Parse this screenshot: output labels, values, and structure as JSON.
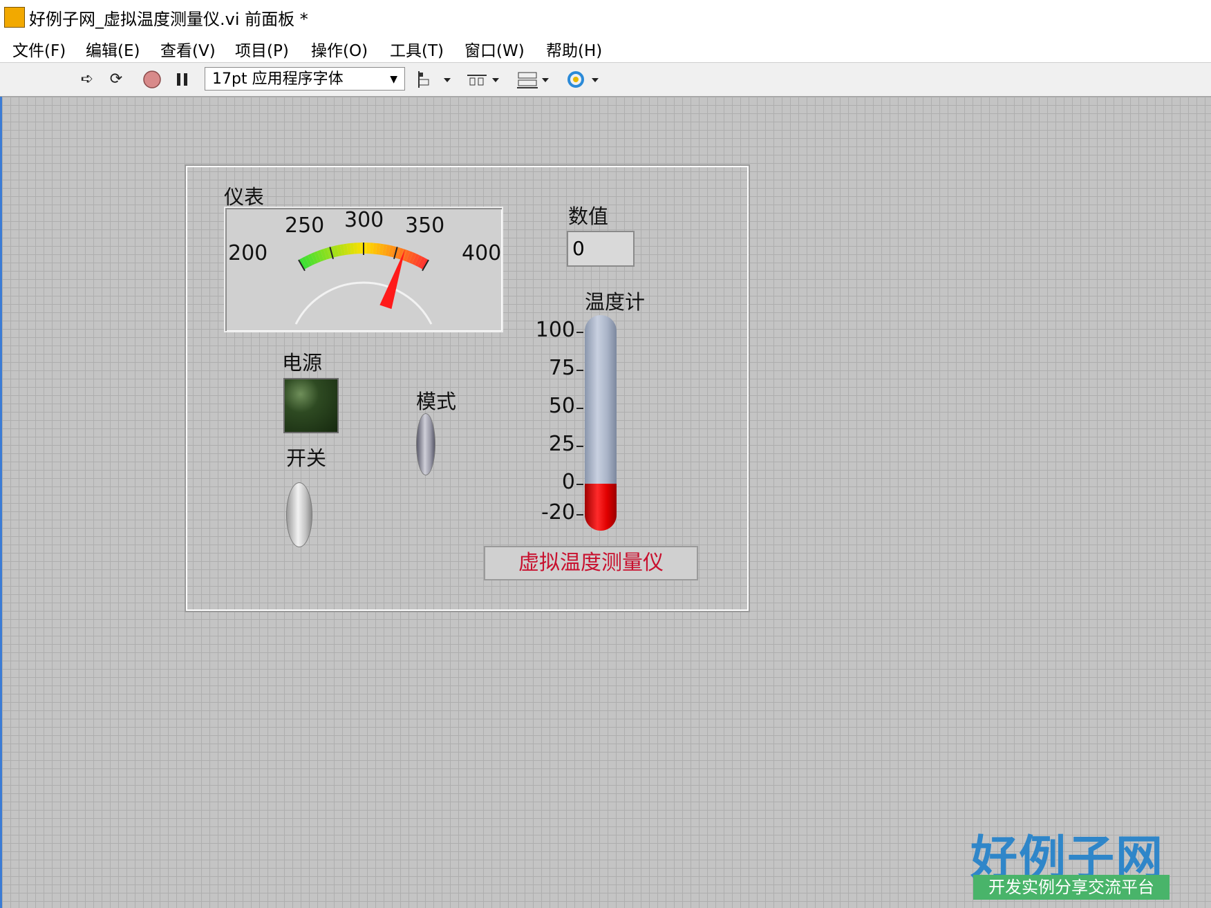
{
  "window": {
    "title": "好例子网_虚拟温度测量仪.vi 前面板 *"
  },
  "menu": [
    "文件(F)",
    "编辑(E)",
    "查看(V)",
    "项目(P)",
    "操作(O)",
    "工具(T)",
    "窗口(W)",
    "帮助(H)"
  ],
  "toolbar": {
    "font_select": "17pt 应用程序字体",
    "icons": [
      "run-arrow-icon",
      "run-continuous-icon",
      "abort-icon",
      "pause-icon",
      "align-icon",
      "distribute-icon",
      "resize-icon",
      "reorder-icon"
    ]
  },
  "gauge": {
    "label": "仪表",
    "min": 200,
    "max": 400,
    "ticks": [
      "200",
      "250",
      "300",
      "350",
      "400"
    ],
    "value": 362,
    "colors": [
      "#35e035",
      "#ffe000",
      "#ff3030"
    ]
  },
  "numeric": {
    "label": "数值",
    "value": "0"
  },
  "thermometer": {
    "label": "温度计",
    "ticks": [
      "100",
      "75",
      "50",
      "25",
      "0",
      "-20"
    ],
    "min": -20,
    "max": 100,
    "value": 0,
    "fill_color": "#ff2a2a"
  },
  "power": {
    "label": "电源",
    "state": "off"
  },
  "switch": {
    "label": "开关"
  },
  "mode": {
    "label": "模式"
  },
  "panel_title": "虚拟温度测量仪",
  "logo": {
    "main": "好例子网",
    "sub": "开发实例分享交流平台"
  }
}
